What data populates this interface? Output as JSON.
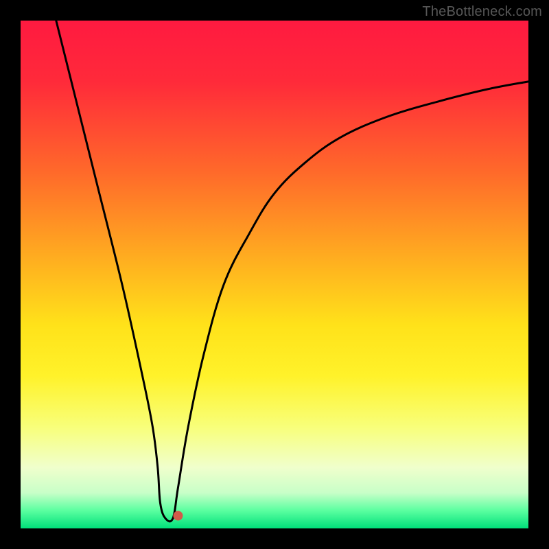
{
  "credit_text": "TheBottleneck.com",
  "chart_data": {
    "type": "line",
    "title": "",
    "xlabel": "",
    "ylabel": "",
    "xlim": [
      0,
      100
    ],
    "ylim": [
      0,
      100
    ],
    "series": [
      {
        "name": "bottleneck-curve",
        "x": [
          7,
          10,
          15,
          20,
          24,
          26,
          27,
          27.5,
          28.5,
          30,
          31,
          33,
          36,
          40,
          45,
          50,
          56,
          63,
          72,
          82,
          92,
          100
        ],
        "values": [
          100,
          88,
          68,
          48,
          30,
          20,
          12,
          5,
          2,
          2,
          8,
          20,
          34,
          48,
          58,
          66,
          72,
          77,
          81,
          84,
          86.5,
          88
        ]
      }
    ],
    "marker": {
      "x": 31,
      "y": 2.5,
      "color": "#d15a4a",
      "r": 7
    },
    "gradient_stops": [
      {
        "offset": 0,
        "color": "#ff1a40"
      },
      {
        "offset": 0.12,
        "color": "#ff2a3a"
      },
      {
        "offset": 0.3,
        "color": "#ff6a2a"
      },
      {
        "offset": 0.48,
        "color": "#ffb21f"
      },
      {
        "offset": 0.6,
        "color": "#ffe21a"
      },
      {
        "offset": 0.7,
        "color": "#fff22a"
      },
      {
        "offset": 0.8,
        "color": "#f8ff7a"
      },
      {
        "offset": 0.88,
        "color": "#f0ffcc"
      },
      {
        "offset": 0.93,
        "color": "#c8ffc8"
      },
      {
        "offset": 0.965,
        "color": "#5affa0"
      },
      {
        "offset": 1.0,
        "color": "#00e07a"
      }
    ]
  }
}
